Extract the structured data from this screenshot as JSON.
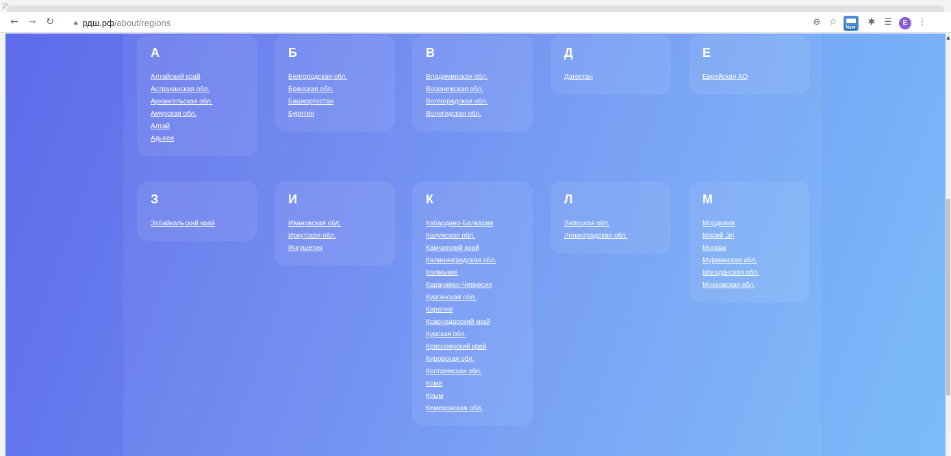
{
  "browser": {
    "url_host": "рдш.рф",
    "url_path": "/about/regions",
    "icons": {
      "back": "arrow-left-icon",
      "forward": "arrow-right-icon",
      "reload": "reload-icon",
      "lock": "lock-icon",
      "zoom": "zoom-icon",
      "bookmark": "star-icon",
      "extension": "new-extension-icon",
      "puzzle": "puzzle-icon",
      "reading_list": "reading-list-icon",
      "menu": "kebab-menu-icon"
    },
    "extension_badge": "New",
    "profile_initial": "E"
  },
  "regions": [
    {
      "letter": "А",
      "items": [
        "Алтайский край",
        "Астраханская обл.",
        "Архангельская обл.",
        "Амурская обл.",
        "Алтай",
        "Адыгея"
      ]
    },
    {
      "letter": "Б",
      "items": [
        "Белгородская обл.",
        "Брянская обл.",
        "Башкортостан",
        "Бурятия"
      ]
    },
    {
      "letter": "В",
      "items": [
        "Владимирская обл.",
        "Воронежская обл.",
        "Волгоградская обл.",
        "Вологодская обл."
      ]
    },
    {
      "letter": "Д",
      "items": [
        "Дагестан"
      ]
    },
    {
      "letter": "Е",
      "items": [
        "Еврейская АО"
      ]
    },
    {
      "letter": "З",
      "items": [
        "Забайкальский край"
      ]
    },
    {
      "letter": "И",
      "items": [
        "Ивановская обл.",
        "Иркутская обл.",
        "Ингушетия"
      ]
    },
    {
      "letter": "К",
      "items": [
        "Кабардино-Балкария",
        "Калужская обл.",
        "Камчатский край",
        "Калининградская обл.",
        "Калмыкия",
        "Карачаево-Черкесия",
        "Курганская обл.",
        "Карелия",
        "Краснодарский край",
        "Курская обл.",
        "Красноярский край",
        "Кировская обл.",
        "Костромская обл.",
        "Коми",
        "Крым",
        "Кемеровская обл."
      ]
    },
    {
      "letter": "Л",
      "items": [
        "Липецкая обл.",
        "Ленинградская обл."
      ]
    },
    {
      "letter": "М",
      "items": [
        "Мордовия",
        "Марий Эл",
        "Москва",
        "Мурманская обл.",
        "Магаданская обл.",
        "Московская обл."
      ]
    }
  ]
}
